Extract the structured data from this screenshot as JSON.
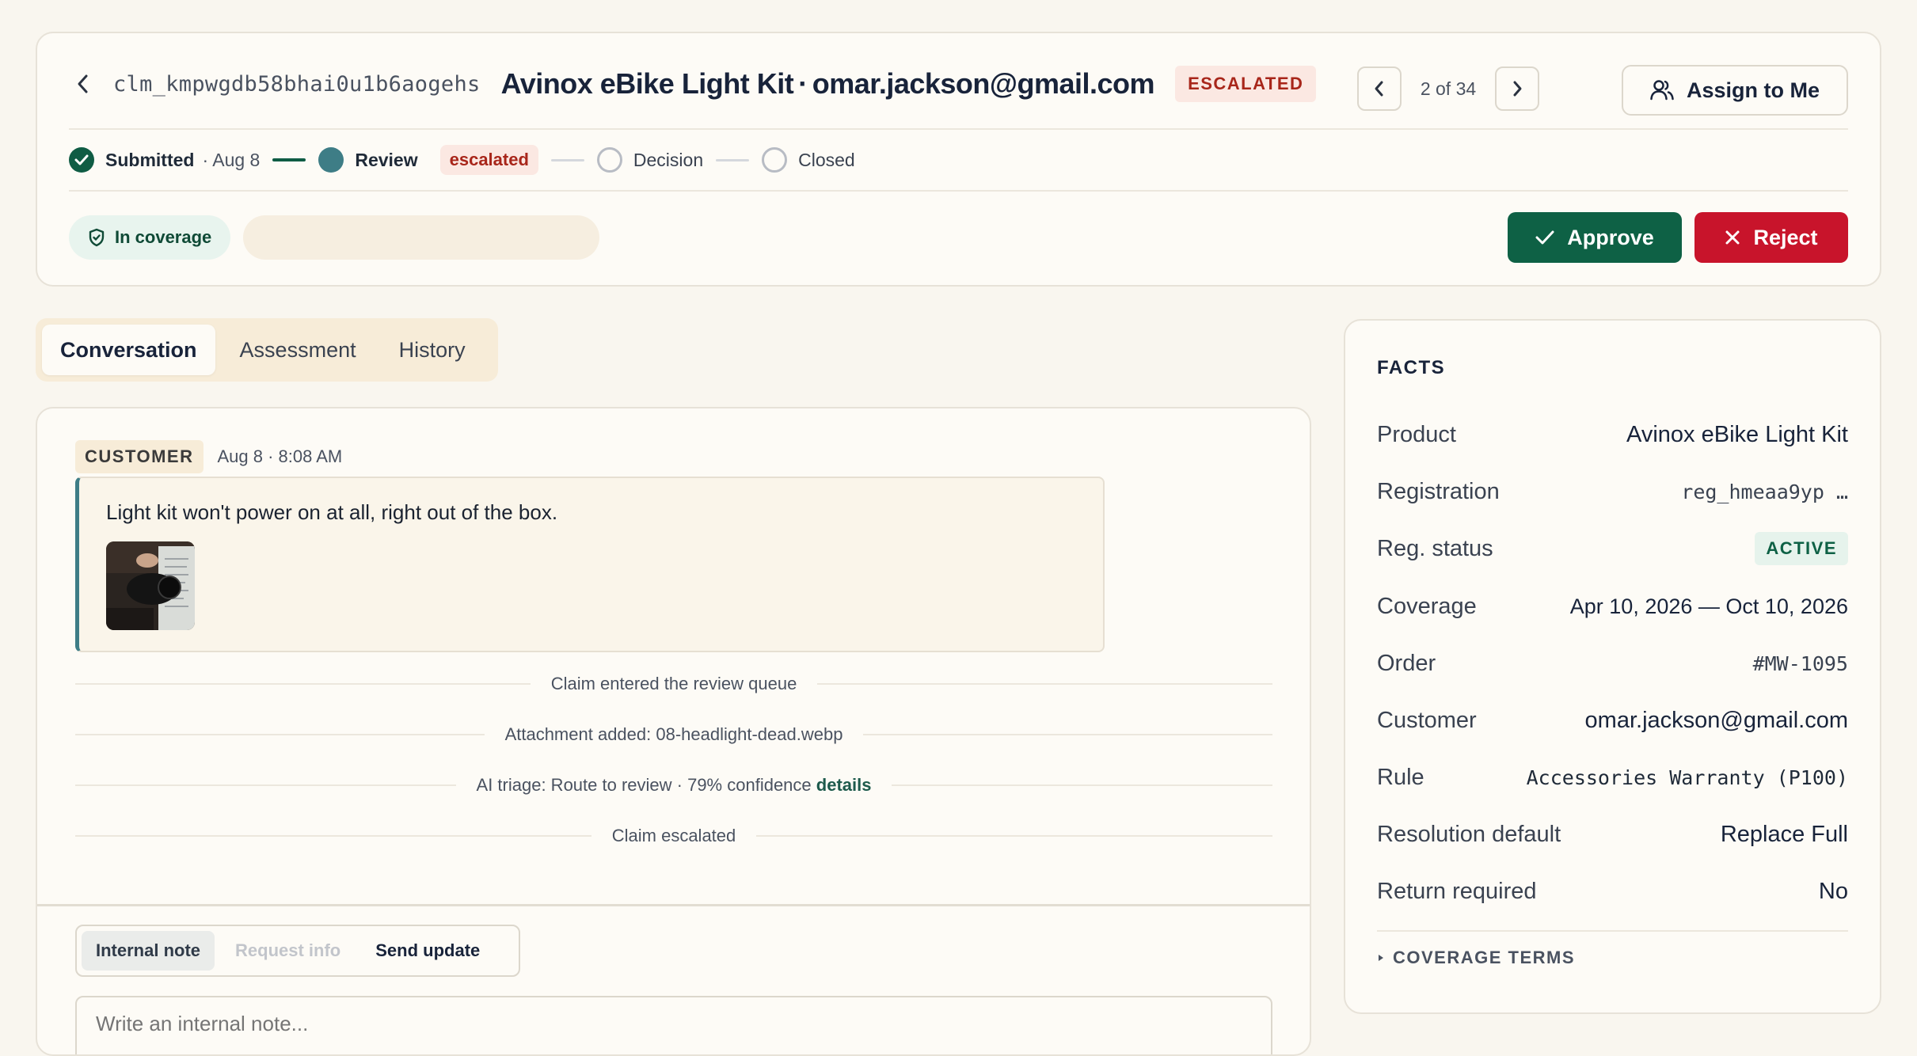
{
  "header": {
    "claim_id": "clm_kmpwgdb58bhai0u1b6aogehs",
    "product": "Avinox eBike Light Kit",
    "title_separator": "·",
    "customer_email": "omar.jackson@gmail.com",
    "status": "ESCALATED",
    "pager_text": "2 of 34",
    "assign_label": "Assign to Me",
    "coverage_label": "In coverage",
    "approve_label": "Approve",
    "reject_label": "Reject"
  },
  "stepper": {
    "steps": [
      {
        "label": "Submitted",
        "date": "· Aug 8",
        "state": "done"
      },
      {
        "label": "Review",
        "tag": "escalated",
        "state": "active"
      },
      {
        "label": "Decision",
        "state": "pending"
      },
      {
        "label": "Closed",
        "state": "pending"
      }
    ]
  },
  "tabs": [
    "Conversation",
    "Assessment",
    "History"
  ],
  "active_tab": "Conversation",
  "conversation": {
    "message": {
      "role": "CUSTOMER",
      "time": "Aug 8 · 8:08 AM",
      "text": "Light kit won't power on at all, right out of the box."
    },
    "events": [
      {
        "text": "Claim entered the review queue"
      },
      {
        "text": "Attachment added: 08-headlight-dead.webp"
      },
      {
        "text": "AI triage: Route to review · 79% confidence",
        "link": "details"
      },
      {
        "text": "Claim escalated"
      }
    ],
    "compose_modes": [
      "Internal note",
      "Request info",
      "Send update"
    ],
    "active_mode": "Internal note",
    "compose_placeholder": "Write an internal note..."
  },
  "facts": {
    "title": "FACTS",
    "rows": [
      {
        "label": "Product",
        "value": "Avinox eBike Light Kit"
      },
      {
        "label": "Registration",
        "value": "reg_hmeaa9yp …"
      },
      {
        "label": "Reg. status",
        "value": "ACTIVE"
      },
      {
        "label": "Coverage",
        "value": "Apr 10, 2026 — Oct 10, 2026"
      },
      {
        "label": "Order",
        "value": "#MW-1095"
      },
      {
        "label": "Customer",
        "value": "omar.jackson@gmail.com"
      },
      {
        "label": "Rule",
        "value": "Accessories Warranty (P100)"
      },
      {
        "label": "Resolution default",
        "value": "Replace Full"
      },
      {
        "label": "Return required",
        "value": "No"
      }
    ],
    "coverage_terms_label": "COVERAGE TERMS"
  },
  "colors": {
    "approve": "#0e6145",
    "reject": "#c8142b",
    "accent_teal": "#3e7d86",
    "escalated": "#a8261a"
  }
}
